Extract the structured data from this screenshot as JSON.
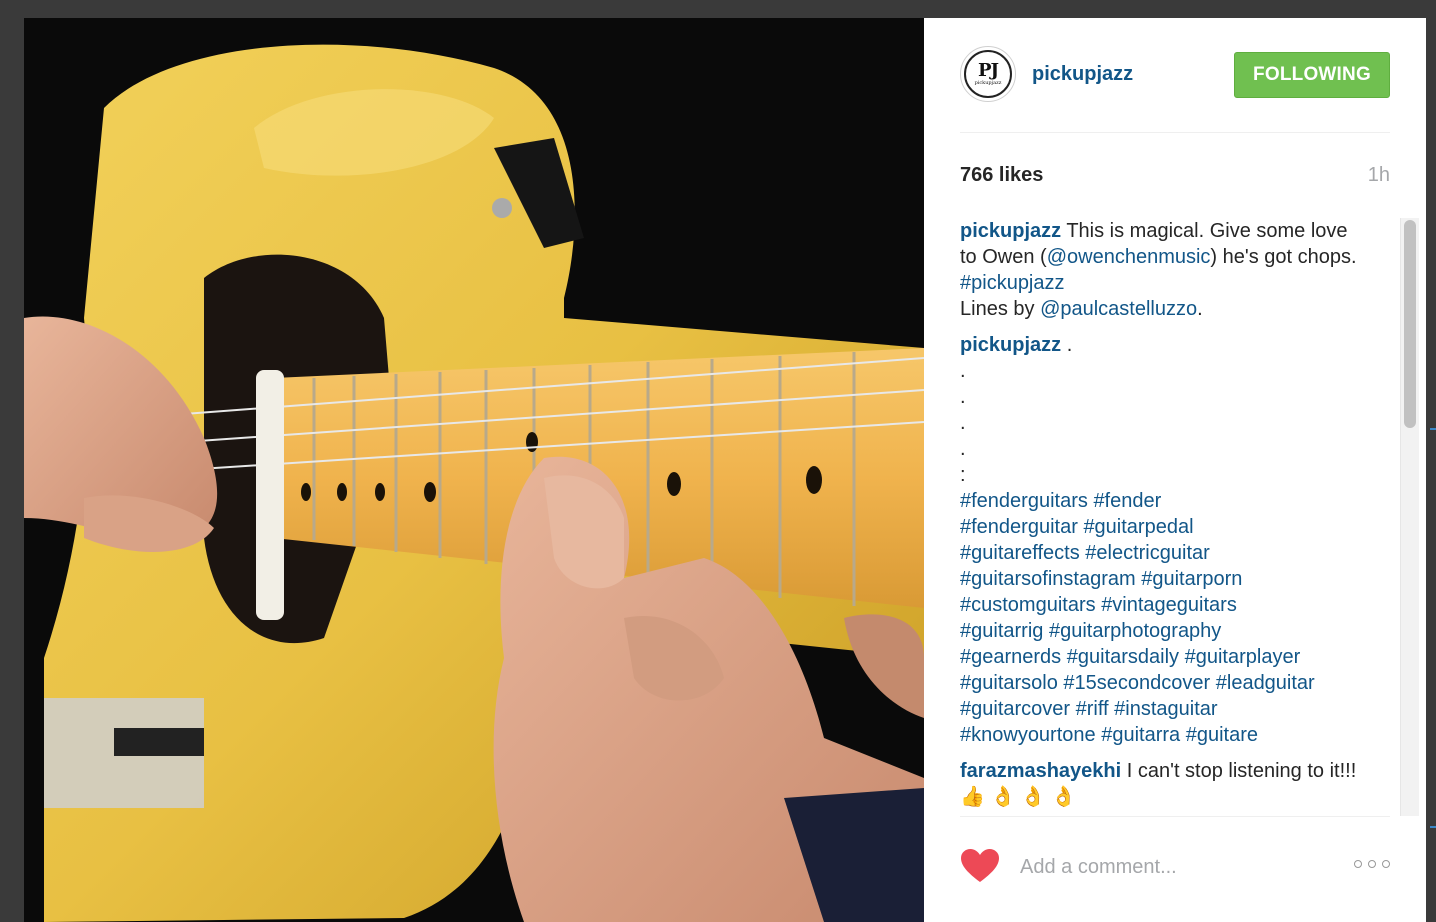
{
  "post": {
    "image_alt": "Close-up of hands playing a yellow electric guitar",
    "colors": {
      "accent": "#125688",
      "follow_green": "#70c050",
      "heart": "#ed4956"
    }
  },
  "header": {
    "avatar_monogram": "PJ",
    "avatar_caption": "pickupjazz",
    "username": "pickupjazz",
    "follow_label": "FOLLOWING"
  },
  "meta": {
    "likes": "766 likes",
    "time": "1h"
  },
  "caption": {
    "author": "pickupjazz",
    "t1": "This is magical. Give some love to Owen (",
    "mention1": "@owenchenmusic",
    "t2": ") he's got chops. ",
    "hashtag1": "#pickupjazz",
    "t3": "Lines by ",
    "mention2": "@paulcastelluzzo",
    "t4": "."
  },
  "comment2": {
    "author": "pickupjazz",
    "first": ".",
    "dots": [
      ".",
      ".",
      ".",
      ".",
      ":"
    ],
    "hashtag_lines": [
      [
        "#fenderguitars",
        "#fender"
      ],
      [
        "#fenderguitar",
        "#guitarpedal"
      ],
      [
        "#guitareffects",
        "#electricguitar"
      ],
      [
        "#guitarsofinstagram",
        "#guitarporn"
      ],
      [
        "#customguitars",
        "#vintageguitars"
      ],
      [
        "#guitarrig",
        "#guitarphotography"
      ],
      [
        "#gearnerds",
        "#guitarsdaily",
        "#guitarplayer"
      ],
      [
        "#guitarsolo",
        "#15secondcover",
        "#leadguitar"
      ],
      [
        "#guitarcover",
        "#riff",
        "#instaguitar"
      ],
      [
        "#knowyourtone",
        "#guitarra",
        "#guitare"
      ]
    ]
  },
  "comment3": {
    "author": "farazmashayekhi",
    "text": "I can't stop listening to it!!! 👍 👌 👌 👌"
  },
  "footer": {
    "placeholder": "Add a comment...",
    "heart_icon": "heart-icon",
    "more_icon": "more-options-icon"
  }
}
